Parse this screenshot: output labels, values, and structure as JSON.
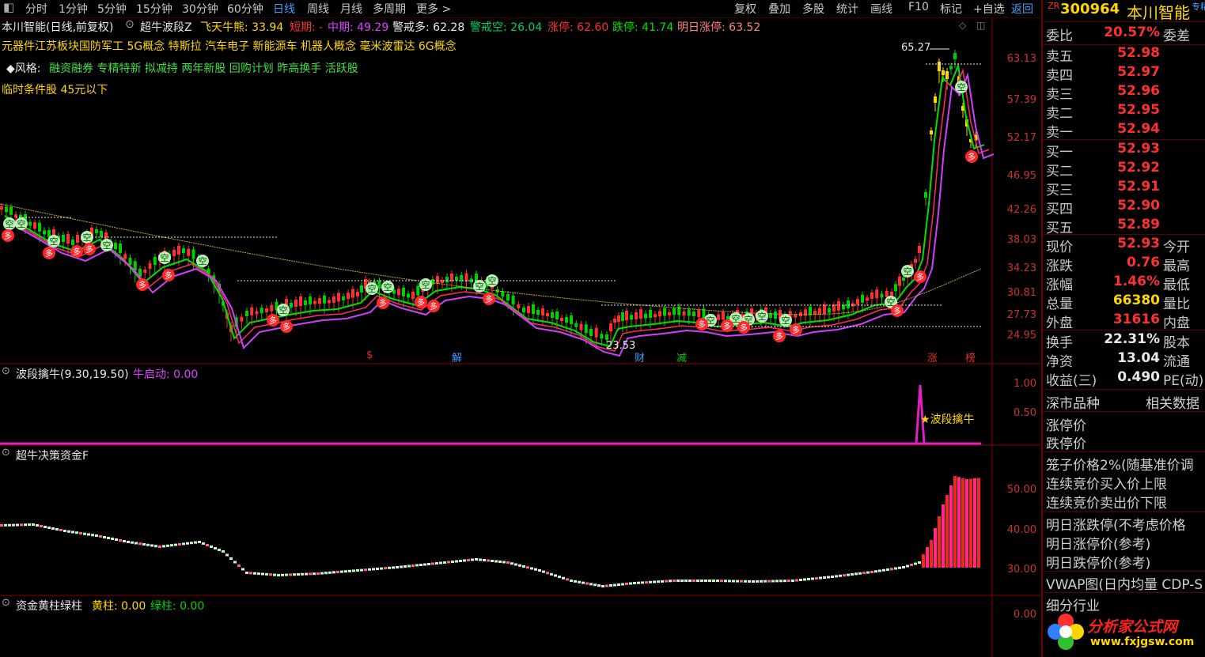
{
  "toolbar": {
    "left": [
      "分时",
      "1分钟",
      "5分钟",
      "15分钟",
      "30分钟",
      "60分钟",
      "日线",
      "周线",
      "月线",
      "多周期",
      "更多 >"
    ],
    "right": [
      "复权",
      "叠加",
      "多股",
      "统计",
      "画线",
      "F10",
      "标记",
      "+自选",
      "返回"
    ]
  },
  "header": {
    "title": "本川智能(日线,前复权)",
    "indicator": "超牛波段Z",
    "f1_label": "飞天牛熊:",
    "f1_value": "33.94",
    "f2_label": "短期:",
    "f2_value": "-",
    "f3_label": "中期:",
    "f3_value": "49.29",
    "f4_label": "警戒多:",
    "f4_value": "62.28",
    "f5_label": "警戒空:",
    "f5_value": "26.04",
    "f6_label": "涨停:",
    "f6_value": "62.60",
    "f7_label": "跌停:",
    "f7_value": "41.74",
    "f8_label": "明日涨停:",
    "f8_value": "63.52",
    "concepts": "元器件江苏板块国防军工 5G概念 特斯拉 汽车电子 新能源车 机器人概念 毫米波雷达 6G概念",
    "style_label": "◆风格:",
    "style_tags": "融资融券 专精特新 拟减持 两年新股 回购计划 昨高换手 活跃股",
    "temp_condition": "临时条件股 45元以下"
  },
  "main_chart": {
    "high_label": "65.27",
    "low_label": "23.53",
    "y_ticks": [
      "63.13",
      "57.39",
      "52.17",
      "46.95",
      "42.26",
      "38.03",
      "34.23",
      "30.81",
      "27.73",
      "24.95"
    ],
    "empty_marker": "空",
    "full_marker": "多",
    "event_marks": [
      {
        "text": "$",
        "color": "#e03030"
      },
      {
        "text": "解",
        "color": "#3ea0ff"
      },
      {
        "text": "财",
        "color": "#3ea0ff"
      },
      {
        "text": "减",
        "color": "#00d000"
      },
      {
        "text": "涨",
        "color": "#e03030"
      },
      {
        "text": "榜",
        "color": "#e03030"
      }
    ]
  },
  "panel2": {
    "name": "波段擒牛(9.30,19.50)",
    "value_label": "牛启动: 0.00",
    "y_ticks": [
      "1.00",
      "0.50"
    ],
    "signal_label": "波段擒牛",
    "signal_star": "★"
  },
  "panel3": {
    "name": "超牛决策资金F",
    "y_ticks": [
      "50.00",
      "40.00",
      "30.00"
    ]
  },
  "panel4": {
    "name": "资金黄柱绿柱",
    "yellow_label": "黄柱: 0.00",
    "green_label": "绿柱: 0.00",
    "y_ticks": [
      "0.00"
    ]
  },
  "quote": {
    "code_prefix": "ZR",
    "code": "300964",
    "name": "本川智能",
    "corner_tag": "专精",
    "weibi_label": "委比",
    "weibi_value": "20.57%",
    "weicha_label": "委差",
    "asks": [
      {
        "label": "卖五",
        "price": "52.98"
      },
      {
        "label": "卖四",
        "price": "52.97"
      },
      {
        "label": "卖三",
        "price": "52.96"
      },
      {
        "label": "卖二",
        "price": "52.95"
      },
      {
        "label": "卖一",
        "price": "52.94"
      }
    ],
    "bids": [
      {
        "label": "买一",
        "price": "52.93"
      },
      {
        "label": "买二",
        "price": "52.92"
      },
      {
        "label": "买三",
        "price": "52.91"
      },
      {
        "label": "买四",
        "price": "52.90"
      },
      {
        "label": "买五",
        "price": "52.89"
      }
    ],
    "stats": [
      {
        "k": "现价",
        "v": "52.93",
        "k2": "今开",
        "color": "#ff3030"
      },
      {
        "k": "涨跌",
        "v": "0.76",
        "k2": "最高",
        "color": "#ff3030"
      },
      {
        "k": "涨幅",
        "v": "1.46%",
        "k2": "最低",
        "color": "#ff3030"
      },
      {
        "k": "总量",
        "v": "66380",
        "k2": "量比",
        "color": "#ffd700"
      },
      {
        "k": "外盘",
        "v": "31616",
        "k2": "内盘",
        "color": "#ff3030"
      }
    ],
    "stats2": [
      {
        "k": "换手",
        "v": "22.31%",
        "k2": "股本",
        "color": "#e8e8e8"
      },
      {
        "k": "净资",
        "v": "13.04",
        "k2": "流通",
        "color": "#e8e8e8"
      },
      {
        "k": "收益(三)",
        "v": "0.490",
        "k2": "PE(动)",
        "color": "#e8e8e8"
      }
    ],
    "market_label": "深市品种",
    "related_label": "相关数据",
    "limits": [
      "涨停价",
      "跌停价"
    ],
    "cage": [
      "笼子价格2%(随基准价调",
      "连续竞价买入价上限",
      "连续竞价卖出价下限"
    ],
    "tomorrow": [
      "明日涨跌停(不考虑价格",
      "明日涨停价(参考)",
      "明日跌停价(参考)"
    ],
    "vwap": "VWAP图(日内均量 CDP-S",
    "industry": "细分行业",
    "logo_text": "分析家公式网",
    "logo_url": "www.fxjgsw.com"
  }
}
